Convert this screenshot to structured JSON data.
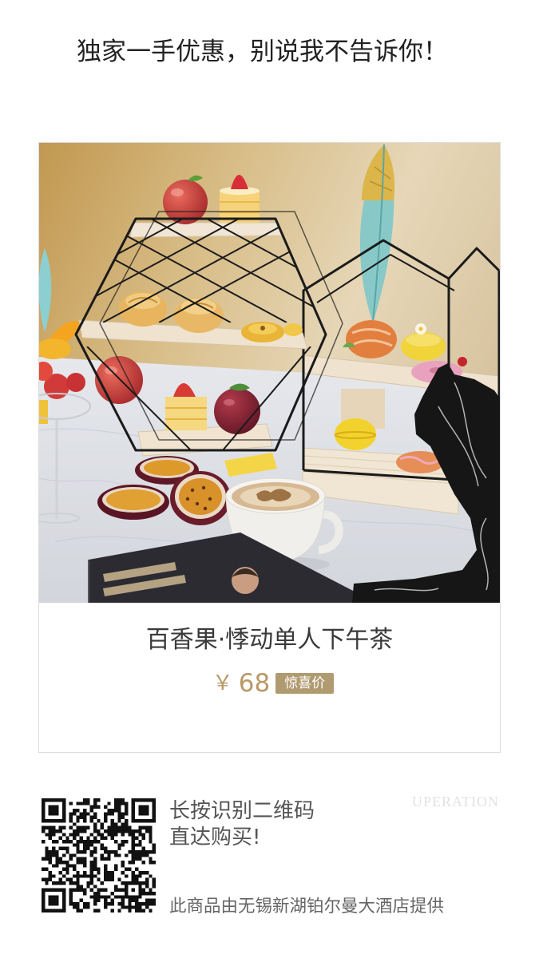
{
  "header": {
    "title": "独家一手优惠，别说我不告诉你！"
  },
  "product": {
    "title": "百香果·悸动单人下午茶",
    "currency": "￥",
    "price": "68",
    "price_tag": "惊喜价"
  },
  "purchase": {
    "qr_hint": "长按识别二维码",
    "qr_action": "直达购买!",
    "provider_note": "此商品由无锡新湖铂尔曼大酒店提供"
  },
  "watermark": {
    "text": "UPERATION"
  },
  "colors": {
    "page_background": "#ffffff",
    "heading_text": "#222222",
    "title_text": "#3a3a3a",
    "price": "#b89a66",
    "price_tag_background": "#b09a70",
    "price_tag_text": "#ffffff",
    "card_border": "#dcdcdc",
    "body_text": "#555555"
  }
}
